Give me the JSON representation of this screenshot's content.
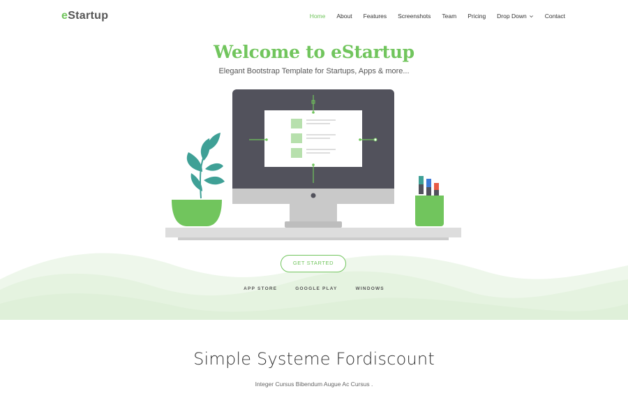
{
  "brand": {
    "prefix": "e",
    "name": "Startup"
  },
  "nav": {
    "items": [
      {
        "label": "Home",
        "active": true
      },
      {
        "label": "About"
      },
      {
        "label": "Features"
      },
      {
        "label": "Screenshots"
      },
      {
        "label": "Team"
      },
      {
        "label": "Pricing"
      },
      {
        "label": "Drop Down",
        "has_dropdown": true
      },
      {
        "label": "Contact"
      }
    ]
  },
  "hero": {
    "title": "Welcome to eStartup",
    "subtitle": "Elegant Bootstrap Template for Startups, Apps & more...",
    "cta_label": "GET STARTED",
    "store_links": [
      "APP STORE",
      "GOOGLE PLAY",
      "WINDOWS"
    ]
  },
  "section": {
    "title": "Simple Systeme Fordiscount",
    "subtitle": "Integer Cursus Bibendum Augue Ac Cursus ."
  },
  "colors": {
    "accent": "#71c55d",
    "hill_light": "#eaf6e6",
    "monitor_bezel": "#52525c",
    "desk": "#dddddd"
  },
  "icons": [
    "chevron-down-icon",
    "plant-icon",
    "monitor-icon",
    "pencil-cup-icon"
  ]
}
